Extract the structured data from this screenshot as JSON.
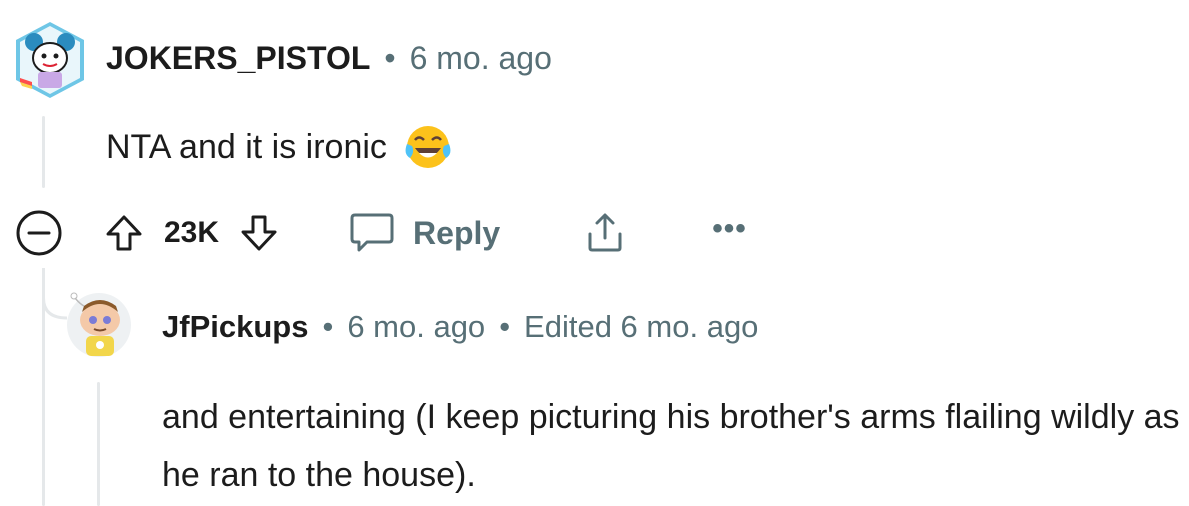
{
  "comment": {
    "username": "JOKERS_PISTOL",
    "separator": "•",
    "time": "6 mo. ago",
    "body": "NTA and it is ironic",
    "emoji": "face-with-tears-of-joy",
    "actions": {
      "vote_count": "23K",
      "reply_label": "Reply",
      "more_label": "•••"
    }
  },
  "reply": {
    "username": "JfPickups",
    "separator": "•",
    "time": "6 mo. ago",
    "separator2": "•",
    "edited": "Edited 6 mo. ago",
    "body": "and entertaining (I keep picturing his brother's arms flailing wildly as he ran to the house)."
  },
  "colors": {
    "meta_gray": "#576f76",
    "thread_line": "#e5e8ea",
    "text": "#1c1c1c"
  },
  "icons": [
    "collapse-minus-icon",
    "upvote-arrow-icon",
    "downvote-arrow-icon",
    "comment-bubble-icon",
    "share-icon",
    "more-options-icon"
  ]
}
